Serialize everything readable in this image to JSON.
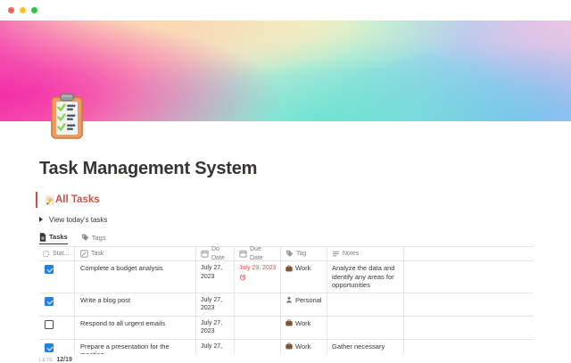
{
  "window": {
    "traffic_lights": {
      "close": "#ff5f57",
      "minimize": "#febc2e",
      "fullscreen": "#28c840"
    }
  },
  "page": {
    "title": "Task Management System",
    "icon": "clipboard-icon",
    "cover": "rainbow-gradient"
  },
  "callout": {
    "icon": "memo-icon",
    "text": "All Tasks",
    "color": "#d44c47"
  },
  "toggle": {
    "label": "View today's tasks"
  },
  "tabs": [
    {
      "label": "Tasks",
      "icon": "document-icon",
      "active": true
    },
    {
      "label": "Tags",
      "icon": "tag-icon",
      "active": false
    }
  ],
  "table": {
    "columns": [
      {
        "label": "Stat...",
        "icon": "status-circle-icon"
      },
      {
        "label": "Task",
        "icon": "pencil-square-icon"
      },
      {
        "label": "Do Date",
        "icon": "calendar-icon"
      },
      {
        "label": "Due Date",
        "icon": "calendar-icon"
      },
      {
        "label": "Tag",
        "icon": "tag-icon"
      },
      {
        "label": "Notes",
        "icon": "text-lines-icon"
      }
    ],
    "rows": [
      {
        "checked": true,
        "task": "Complete a budget analysis",
        "do_date": "July 27, 2023",
        "due_date": "July 29, 2023",
        "due_overdue": true,
        "due_icon": "alarm-clock-icon",
        "tag": {
          "icon": "briefcase-icon",
          "label": "Work"
        },
        "notes": "Analyze the data and identify any areas for opportunities"
      },
      {
        "checked": true,
        "task": "Write a blog post",
        "do_date": "July 27, 2023",
        "due_date": "",
        "tag": {
          "icon": "person-icon",
          "label": "Personal"
        },
        "notes": ""
      },
      {
        "checked": false,
        "task": "Respond to all urgent emails",
        "do_date": "July 27, 2023",
        "due_date": "",
        "tag": {
          "icon": "briefcase-icon",
          "label": "Work"
        },
        "notes": ""
      },
      {
        "checked": true,
        "task": "Prepare a presentation for the meeting",
        "do_date": "July 27,",
        "due_date": "",
        "tag": {
          "icon": "briefcase-icon",
          "label": "Work"
        },
        "notes": "Gather necessary"
      }
    ],
    "footer": {
      "label": "LETE",
      "value": "12/19"
    }
  },
  "colors": {
    "text": "#37352f",
    "secondary": "#7d7c78",
    "border": "#e7e6e3",
    "accent_red": "#d44c47",
    "overdue_red": "#e0544c",
    "checkbox_blue": "#2383e2"
  }
}
